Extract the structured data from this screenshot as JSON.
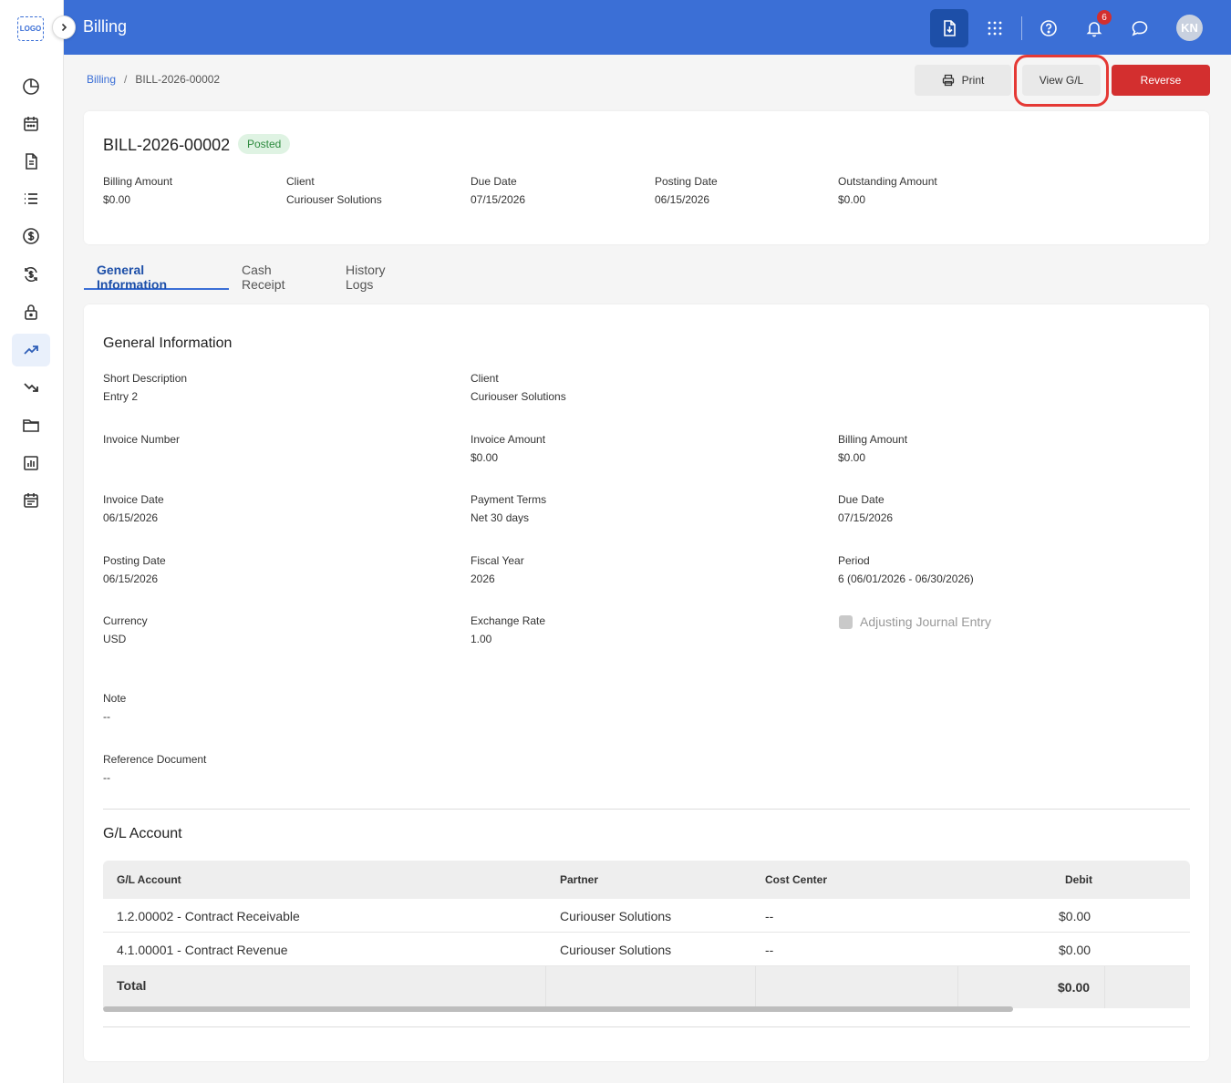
{
  "app": {
    "logo_text": "LOGO",
    "title": "Billing"
  },
  "header": {
    "notification_count": "6",
    "avatar_initials": "KN"
  },
  "breadcrumb": {
    "root": "Billing",
    "separator": "/",
    "current": "BILL-2026-00002"
  },
  "actions": {
    "print": "Print",
    "view_gl": "View G/L",
    "reverse": "Reverse"
  },
  "summary": {
    "bill_id": "BILL-2026-00002",
    "status": "Posted",
    "fields": [
      {
        "label": "Billing Amount",
        "value": "$0.00"
      },
      {
        "label": "Client",
        "value": "Curiouser Solutions"
      },
      {
        "label": "Due Date",
        "value": "07/15/2026"
      },
      {
        "label": "Posting Date",
        "value": "06/15/2026"
      },
      {
        "label": "Outstanding Amount",
        "value": "$0.00"
      }
    ]
  },
  "tabs": [
    "General Information",
    "Cash Receipt",
    "History Logs"
  ],
  "general": {
    "title": "General Information",
    "short_description": {
      "label": "Short Description",
      "value": "Entry 2"
    },
    "client": {
      "label": "Client",
      "value": "Curiouser Solutions"
    },
    "invoice_number": {
      "label": "Invoice Number",
      "value": ""
    },
    "invoice_amount": {
      "label": "Invoice Amount",
      "value": "$0.00"
    },
    "billing_amount": {
      "label": "Billing Amount",
      "value": "$0.00"
    },
    "invoice_date": {
      "label": "Invoice Date",
      "value": "06/15/2026"
    },
    "payment_terms": {
      "label": "Payment Terms",
      "value": "Net 30 days"
    },
    "due_date": {
      "label": "Due Date",
      "value": "07/15/2026"
    },
    "posting_date": {
      "label": "Posting Date",
      "value": "06/15/2026"
    },
    "fiscal_year": {
      "label": "Fiscal Year",
      "value": "2026"
    },
    "period": {
      "label": "Period",
      "value": "6 (06/01/2026 - 06/30/2026)"
    },
    "currency": {
      "label": "Currency",
      "value": "USD"
    },
    "exchange_rate": {
      "label": "Exchange Rate",
      "value": "1.00"
    },
    "adjusting_entry": {
      "label": "Adjusting Journal Entry"
    },
    "note": {
      "label": "Note",
      "value": "--"
    },
    "reference_document": {
      "label": "Reference Document",
      "value": "--"
    }
  },
  "gl": {
    "title": "G/L Account",
    "headers": {
      "account": "G/L Account",
      "partner": "Partner",
      "cost_center": "Cost Center",
      "debit": "Debit"
    },
    "rows": [
      {
        "account": "1.2.00002 - Contract Receivable",
        "partner": "Curiouser Solutions",
        "cost_center": "--",
        "debit": "$0.00"
      },
      {
        "account": "4.1.00001 - Contract Revenue",
        "partner": "Curiouser Solutions",
        "cost_center": "--",
        "debit": "$0.00"
      }
    ],
    "total": {
      "label": "Total",
      "debit": "$0.00"
    }
  },
  "colors": {
    "primary": "#3b6fd6",
    "danger": "#d32f2f",
    "success_bg": "#dff3e3",
    "success_text": "#2e8b3f"
  }
}
